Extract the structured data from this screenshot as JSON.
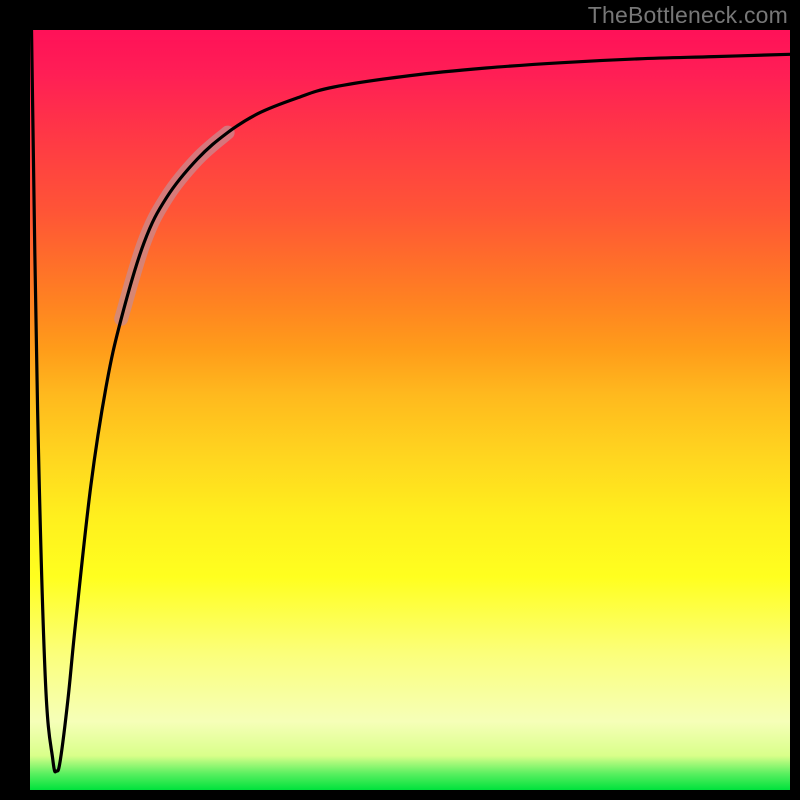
{
  "watermark": "TheBottleneck.com",
  "colors": {
    "frame": "#000000",
    "curve": "#000000",
    "highlight": "#c98a8f",
    "gradient_stops": [
      "#00e23c",
      "#5cf061",
      "#d9ff8a",
      "#f6ffb8",
      "#fbff7a",
      "#ffff1f",
      "#ffef1e",
      "#ffd51f",
      "#ffb91e",
      "#ff9c1a",
      "#ff8321",
      "#ff6c2b",
      "#ff5536",
      "#ff443f",
      "#ff3249",
      "#ff1f55",
      "#ff1158"
    ]
  },
  "chart_data": {
    "type": "line",
    "title": "",
    "xlabel": "",
    "ylabel": "",
    "xlim": [
      0,
      100
    ],
    "ylim": [
      0,
      100
    ],
    "legend": false,
    "grid": false,
    "note": "y is plotted top-to-bottom (0 at top, 100 at bottom); curve shows a sharp spike down near x≈3.5 then asymptotically approaches y≈3 toward the right",
    "series": [
      {
        "name": "bottleneck-curve",
        "x": [
          0.2,
          1.0,
          2.0,
          3.0,
          3.5,
          4.0,
          5.0,
          6.0,
          8.0,
          10.0,
          12.0,
          15.0,
          18.0,
          22.0,
          26.0,
          30.0,
          35.0,
          40.0,
          50.0,
          60.0,
          70.0,
          80.0,
          90.0,
          100.0
        ],
        "y": [
          0.0,
          50.0,
          85.0,
          96.0,
          97.5,
          96.0,
          88.0,
          78.0,
          60.0,
          47.0,
          38.0,
          28.0,
          22.0,
          17.0,
          13.5,
          11.0,
          9.0,
          7.5,
          6.0,
          5.0,
          4.3,
          3.8,
          3.5,
          3.2
        ]
      }
    ],
    "highlight_segment": {
      "x_start": 15,
      "x_end": 22
    }
  }
}
